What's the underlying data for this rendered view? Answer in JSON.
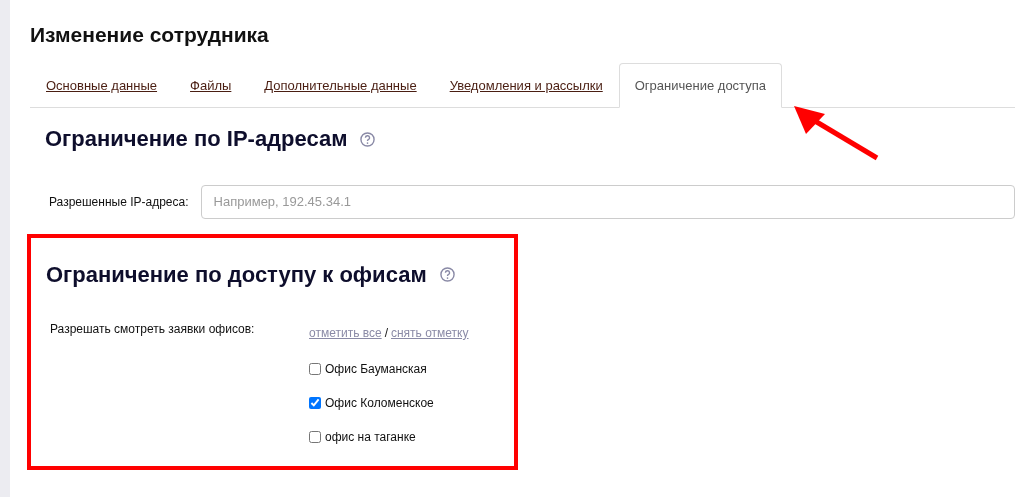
{
  "page": {
    "title": "Изменение сотрудника"
  },
  "tabs": [
    {
      "label": "Основные данные",
      "selected": false
    },
    {
      "label": "Файлы",
      "selected": false
    },
    {
      "label": "Дополнительные данные",
      "selected": false
    },
    {
      "label": "Уведомления и рассылки",
      "selected": false
    },
    {
      "label": "Ограничение доступа",
      "selected": true
    }
  ],
  "ip_section": {
    "heading": "Ограничение по IP-адресам",
    "field_label": "Разрешенные IP-адреса:",
    "placeholder": "Например, 192.45.34.1"
  },
  "office_section": {
    "heading": "Ограничение по доступу к офисам",
    "field_label": "Разрешать смотреть заявки офисов:",
    "select_all": "отметить все",
    "separator": "/",
    "deselect_all": "снять отметку",
    "offices": [
      {
        "label": "Офис Бауманская",
        "checked": false
      },
      {
        "label": "Офис Коломенское",
        "checked": true
      },
      {
        "label": "офис на таганке",
        "checked": false
      }
    ]
  }
}
